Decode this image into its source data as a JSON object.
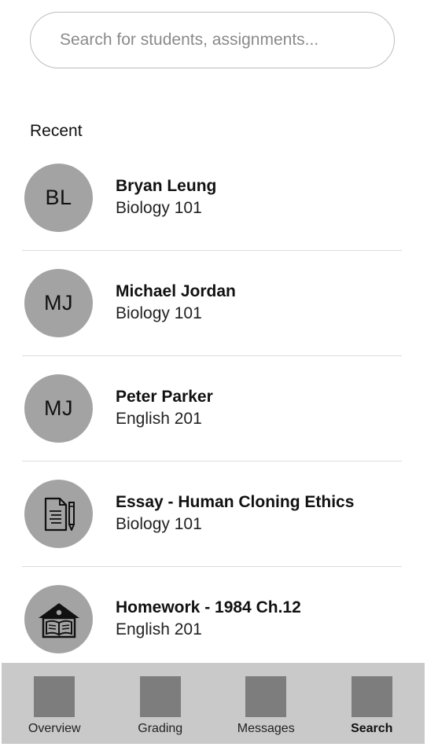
{
  "search": {
    "placeholder": "Search for students, assignments..."
  },
  "recent": {
    "title": "Recent",
    "items": [
      {
        "avatar_text": "BL",
        "title": "Bryan Leung",
        "subtitle": "Biology 101"
      },
      {
        "avatar_text": "MJ",
        "title": "Michael Jordan",
        "subtitle": "Biology 101"
      },
      {
        "avatar_text": "MJ",
        "title": "Peter Parker",
        "subtitle": "English 201"
      },
      {
        "icon": "document-pen-icon",
        "title": "Essay - Human Cloning Ethics",
        "subtitle": "Biology 101"
      },
      {
        "icon": "school-book-icon",
        "title": "Homework - 1984 Ch.12",
        "subtitle": "English 201"
      }
    ]
  },
  "nav": {
    "active": "Search",
    "items": [
      {
        "label": "Overview"
      },
      {
        "label": "Grading"
      },
      {
        "label": "Messages"
      },
      {
        "label": "Search"
      }
    ]
  },
  "colors": {
    "avatar_bg": "#a3a3a3",
    "navbar_bg": "#c9c9c9",
    "nav_icon": "#7d7d7d",
    "divider": "#dcdcdc"
  }
}
